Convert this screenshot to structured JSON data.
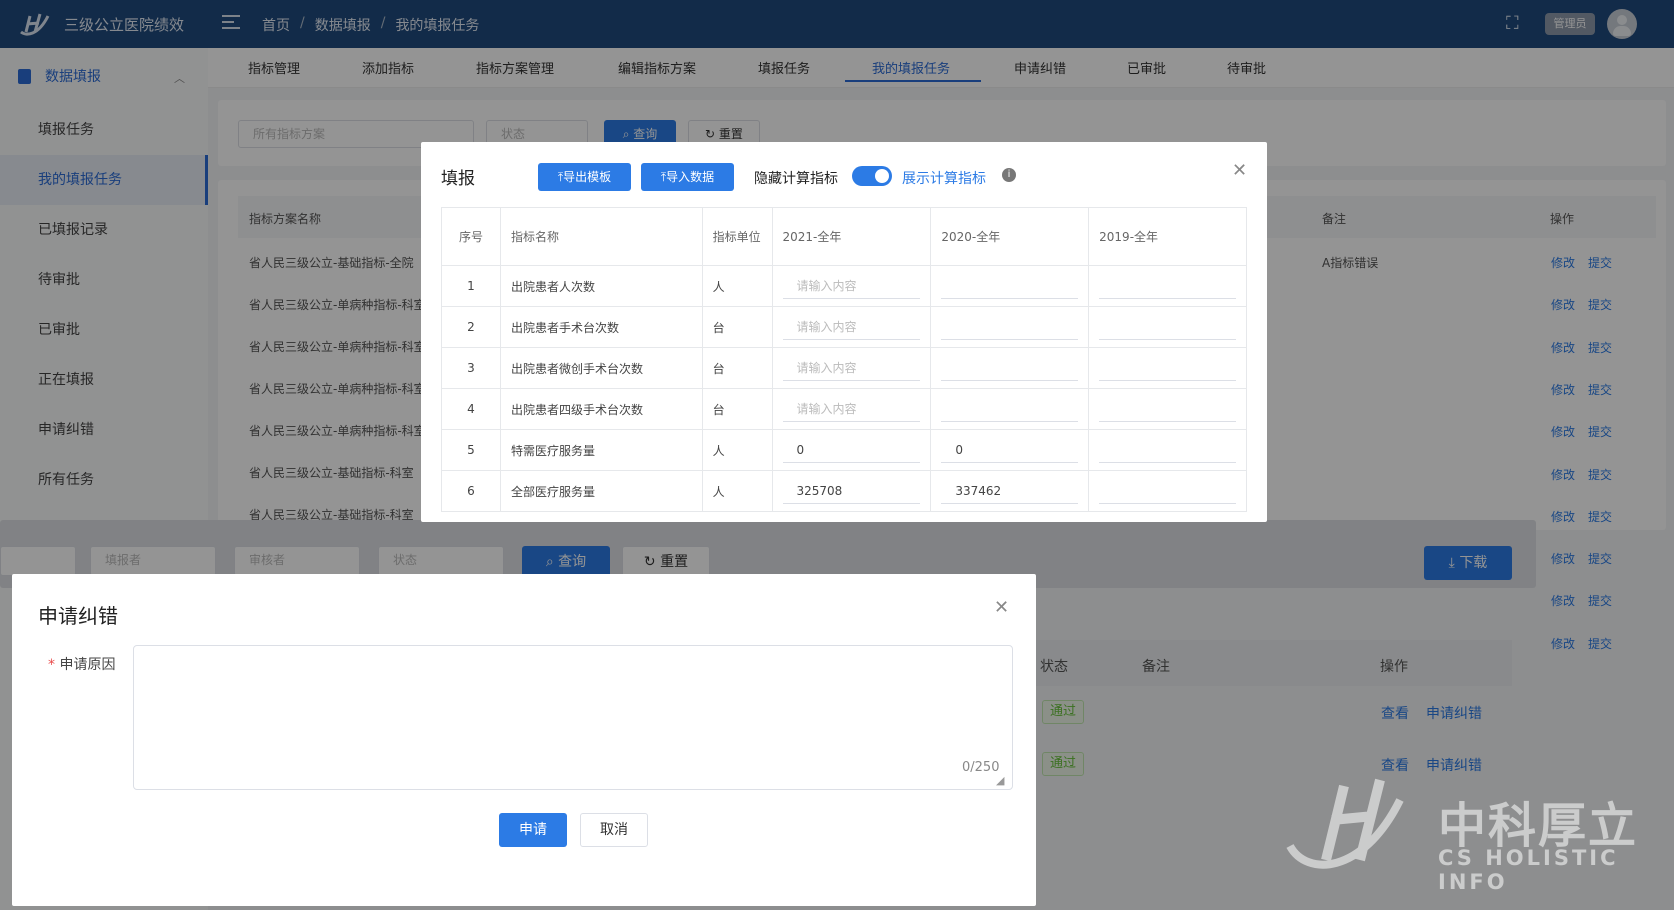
{
  "header": {
    "app_title": "三级公立医院绩效",
    "breadcrumb": [
      "首页",
      "数据填报",
      "我的填报任务"
    ],
    "user_label": "管理员"
  },
  "sidebar": {
    "group": "数据填报",
    "items": [
      "填报任务",
      "我的填报任务",
      "已填报记录",
      "待审批",
      "已审批",
      "正在填报",
      "申请纠错",
      "所有任务"
    ],
    "active_index": 1
  },
  "tabs": {
    "items": [
      "指标管理",
      "添加指标",
      "指标方案管理",
      "编辑指标方案",
      "填报任务",
      "我的填报任务",
      "申请纠错",
      "已审批",
      "待审批"
    ],
    "active": "我的填报任务"
  },
  "bg_filters": {
    "scheme_placeholder": "所有指标方案",
    "status_placeholder": "状态",
    "query": "查询",
    "reset": "重置"
  },
  "bg_table": {
    "header_name": "指标方案名称",
    "header_note": "备注",
    "header_ops": "操作",
    "rows": [
      {
        "name": "省人民三级公立-基础指标-全院",
        "note": "A指标错误"
      },
      {
        "name": "省人民三级公立-单病种指标-科室",
        "note": ""
      },
      {
        "name": "省人民三级公立-单病种指标-科室",
        "note": ""
      },
      {
        "name": "省人民三级公立-单病种指标-科室",
        "note": ""
      },
      {
        "name": "省人民三级公立-单病种指标-科室",
        "note": ""
      },
      {
        "name": "省人民三级公立-基础指标-科室",
        "note": ""
      },
      {
        "name": "省人民三级公立-基础指标-科室",
        "note": ""
      }
    ],
    "op_edit": "修改",
    "op_submit": "提交",
    "op_rows": 10
  },
  "bg2": {
    "filler_placeholder": "填报者",
    "reviewer_placeholder": "审核者",
    "status_placeholder": "状态",
    "query": "查询",
    "reset": "重置",
    "download": "下载",
    "col_status": "状态",
    "col_note": "备注",
    "col_ops": "操作",
    "rows": [
      {
        "status": "通过",
        "view": "查看",
        "correct": "申请纠错"
      },
      {
        "status": "通过",
        "view": "查看",
        "correct": "申请纠错"
      }
    ]
  },
  "fill_dialog": {
    "title": "填报",
    "export_btn": "导出模板",
    "import_btn": "导入数据",
    "hide_label": "隐藏计算指标",
    "show_label": "展示计算指标",
    "toggle_on": true,
    "columns": [
      "序号",
      "指标名称",
      "指标单位",
      "2021-全年",
      "2020-全年",
      "2019-全年"
    ],
    "input_placeholder": "请输入内容",
    "rows": [
      {
        "no": "1",
        "name": "出院患者人次数",
        "unit": "人",
        "v2021": "",
        "v2020": "",
        "v2019": ""
      },
      {
        "no": "2",
        "name": "出院患者手术台次数",
        "unit": "台",
        "v2021": "",
        "v2020": "",
        "v2019": ""
      },
      {
        "no": "3",
        "name": "出院患者微创手术台次数",
        "unit": "台",
        "v2021": "",
        "v2020": "",
        "v2019": ""
      },
      {
        "no": "4",
        "name": "出院患者四级手术台次数",
        "unit": "台",
        "v2021": "",
        "v2020": "",
        "v2019": ""
      },
      {
        "no": "5",
        "name": "特需医疗服务量",
        "unit": "人",
        "v2021": "0",
        "v2020": "0",
        "v2019": ""
      },
      {
        "no": "6",
        "name": "全部医疗服务量",
        "unit": "人",
        "v2021": "325708",
        "v2020": "337462",
        "v2019": ""
      }
    ]
  },
  "correct_dialog": {
    "title": "申请纠错",
    "reason_label": "申请原因",
    "required_mark": "*",
    "reason_value": "",
    "counter": "0/250",
    "submit": "申请",
    "cancel": "取消"
  },
  "watermark": {
    "cn": "中科厚立",
    "en": "CS HOLISTIC INFO"
  },
  "colors": {
    "header_bg": "#1f4a7f",
    "primary": "#2c7be5",
    "pass_green": "#67c23a"
  }
}
